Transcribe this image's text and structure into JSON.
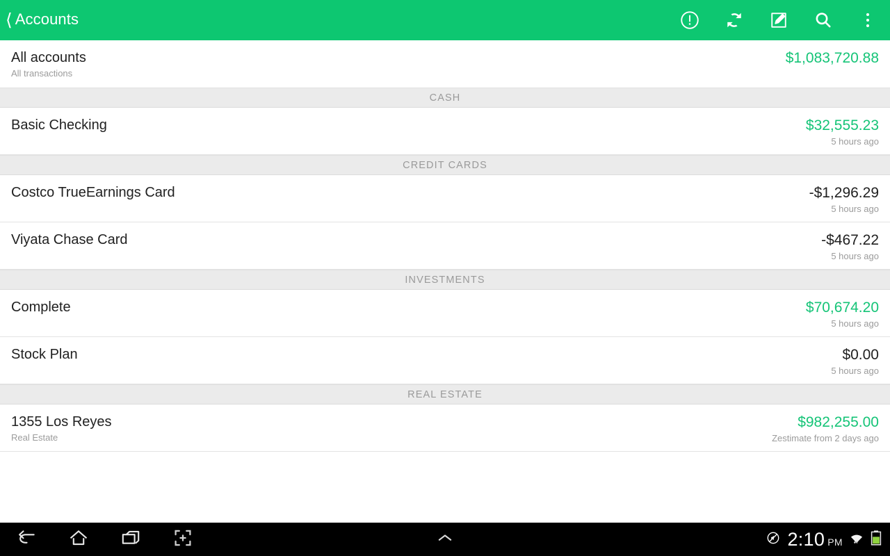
{
  "appbar": {
    "back_icon": "back-chevron-icon",
    "title": "Accounts",
    "actions": [
      {
        "name": "alerts-icon",
        "label": "Alerts"
      },
      {
        "name": "refresh-icon",
        "label": "Refresh"
      },
      {
        "name": "compose-icon",
        "label": "Add transaction"
      },
      {
        "name": "search-icon",
        "label": "Search"
      },
      {
        "name": "overflow-menu-icon",
        "label": "More options"
      }
    ],
    "background_color": "#0dc771"
  },
  "colors": {
    "accent_green": "#0dc771",
    "positive_amount": "#15c477",
    "negative_amount": "#212121",
    "section_band": "#ebebeb",
    "section_label": "#9a9a9a",
    "subtitle": "#9b9b9b"
  },
  "total_row": {
    "name": "All accounts",
    "subtitle": "All transactions",
    "amount": "$1,083,720.88",
    "amount_positive": true
  },
  "sections": [
    {
      "label": "CASH",
      "rows": [
        {
          "name": "Basic Checking",
          "subtitle": "",
          "amount": "$32,555.23",
          "amount_positive": true,
          "time": "5 hours ago"
        }
      ]
    },
    {
      "label": "CREDIT CARDS",
      "rows": [
        {
          "name": "Costco TrueEarnings Card",
          "subtitle": "",
          "amount": "-$1,296.29",
          "amount_positive": false,
          "time": "5 hours ago"
        },
        {
          "name": "Viyata Chase Card",
          "subtitle": "",
          "amount": "-$467.22",
          "amount_positive": false,
          "time": "5 hours ago"
        }
      ]
    },
    {
      "label": "INVESTMENTS",
      "rows": [
        {
          "name": "Complete",
          "subtitle": "",
          "amount": "$70,674.20",
          "amount_positive": true,
          "time": "5 hours ago"
        },
        {
          "name": "Stock Plan",
          "subtitle": "",
          "amount": "$0.00",
          "amount_positive": false,
          "time": "5 hours ago"
        }
      ]
    },
    {
      "label": "REAL ESTATE",
      "rows": [
        {
          "name": "1355  Los Reyes",
          "subtitle": "Real Estate",
          "amount": "$982,255.00",
          "amount_positive": true,
          "time": "Zestimate from 2 days ago"
        }
      ]
    }
  ],
  "navbar": {
    "buttons": [
      {
        "name": "back-nav-icon",
        "label": "Back"
      },
      {
        "name": "home-nav-icon",
        "label": "Home"
      },
      {
        "name": "recent-apps-nav-icon",
        "label": "Recent apps"
      },
      {
        "name": "screenshot-nav-icon",
        "label": "Screenshot"
      }
    ],
    "expand_icon": "chevron-up-icon",
    "status": {
      "mute_icon": "mute-icon",
      "time": "2:10",
      "ampm": "PM",
      "wifi_icon": "wifi-icon",
      "battery_icon": "battery-icon"
    }
  }
}
